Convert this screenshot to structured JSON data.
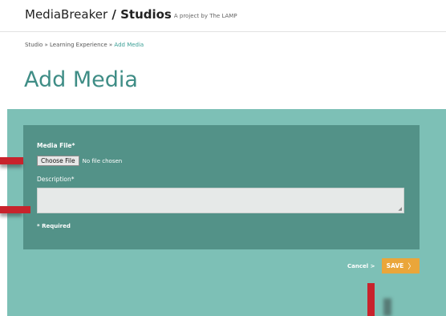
{
  "header": {
    "brand": "MediaBreaker",
    "separator": " / ",
    "product": "Studios",
    "tagline": "A project by The LAMP"
  },
  "breadcrumb": {
    "items": [
      "Studio",
      "Learning Experience"
    ],
    "separator": " » ",
    "current": "Add Media"
  },
  "page": {
    "title": "Add Media"
  },
  "form": {
    "media_file_label": "Media File*",
    "choose_file_label": "Choose File",
    "no_file_text": "No file chosen",
    "description_label": "Description*",
    "description_value": "",
    "required_note": "* Required"
  },
  "actions": {
    "cancel_label": "Cancel >",
    "save_label": "SAVE",
    "save_chevron": "〉"
  },
  "colors": {
    "title": "#3f8d86",
    "panel": "#7dc0b6",
    "form_box": "#539288",
    "save": "#eaa63a",
    "marker": "#c8232c"
  }
}
